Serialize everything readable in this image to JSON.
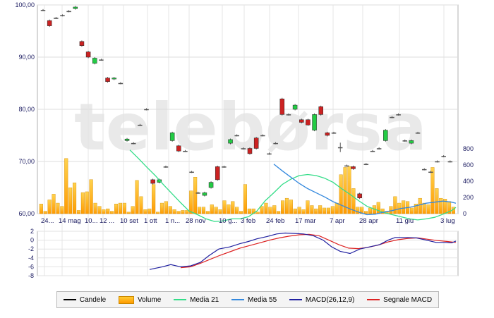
{
  "chart_data": {
    "type": "candlestick",
    "watermark": "telebørsa",
    "price_axis": {
      "range": [
        60,
        100
      ],
      "ticks": [
        "60,00",
        "70,00",
        "80,00",
        "90,00",
        "100,00"
      ]
    },
    "volume_axis": {
      "range": [
        0,
        1000
      ],
      "ticks": [
        "0",
        "200",
        "400",
        "600",
        "800"
      ]
    },
    "macd_axis": {
      "range": [
        -8,
        2
      ],
      "ticks": [
        "2",
        "0",
        "-2",
        "-4",
        "-6",
        "-8"
      ]
    },
    "x_labels": [
      "24...",
      "14 mag",
      "10...",
      "12 ...",
      "10 set",
      "1 ott",
      "1 n...",
      "28 nov",
      "10 g...",
      "3 feb",
      "24 feb",
      "17 mar",
      "7 apr",
      "28 apr",
      "11 giu",
      "3 lug"
    ],
    "legend": [
      {
        "label": "Candele",
        "kind": "line",
        "color": "#000000"
      },
      {
        "label": "Volume",
        "kind": "bar",
        "color": "#ffb000"
      },
      {
        "label": "Media 21",
        "kind": "line",
        "color": "#33dd88"
      },
      {
        "label": "Media 55",
        "kind": "line",
        "color": "#3388dd"
      },
      {
        "label": "MACD(26,12,9)",
        "kind": "line",
        "color": "#2020a0"
      },
      {
        "label": "Segnale MACD",
        "kind": "line",
        "color": "#dd2222"
      }
    ],
    "candles": [
      {
        "o": 99,
        "c": 99,
        "h": 99.2,
        "l": 98.8
      },
      {
        "o": 97,
        "c": 96,
        "h": 97.2,
        "l": 95.8
      },
      {
        "o": 97.5,
        "c": 97.5,
        "h": 97.7,
        "l": 97.3
      },
      {
        "o": 98,
        "c": 98,
        "h": 98.2,
        "l": 97.8
      },
      {
        "o": 98.8,
        "c": 98.8,
        "h": 99,
        "l": 98.6
      },
      {
        "o": 99.3,
        "c": 99.6,
        "h": 99.8,
        "l": 99.1
      },
      {
        "o": 93,
        "c": 92.2,
        "h": 93.2,
        "l": 92
      },
      {
        "o": 91,
        "c": 90,
        "h": 91.2,
        "l": 89.8
      },
      {
        "o": 88.8,
        "c": 89.8,
        "h": 90,
        "l": 88.6
      },
      {
        "o": 89.5,
        "c": 89.5,
        "h": 89.7,
        "l": 89.3
      },
      {
        "o": 86,
        "c": 85.3,
        "h": 86.2,
        "l": 85.1
      },
      {
        "o": 85.8,
        "c": 86,
        "h": 86.2,
        "l": 85.6
      },
      {
        "o": 85,
        "c": 85,
        "h": 85.2,
        "l": 84.8
      },
      {
        "o": 74,
        "c": 74.3,
        "h": 74.5,
        "l": 73.8
      },
      {
        "o": 73.5,
        "c": 73.5,
        "h": 73.7,
        "l": 73.3
      },
      {
        "o": 77,
        "c": 77,
        "h": 77.2,
        "l": 76.8
      },
      {
        "o": 80,
        "c": 80,
        "h": 80.2,
        "l": 79.8
      },
      {
        "o": 66.5,
        "c": 65.8,
        "h": 66.7,
        "l": 65.6
      },
      {
        "o": 66,
        "c": 66.5,
        "h": 66.7,
        "l": 65.8
      },
      {
        "o": 69,
        "c": 69,
        "h": 69.2,
        "l": 68.8
      },
      {
        "o": 74,
        "c": 75.5,
        "h": 75.7,
        "l": 73.8
      },
      {
        "o": 73,
        "c": 72,
        "h": 73.2,
        "l": 71.8
      },
      {
        "o": 72,
        "c": 72,
        "h": 72.2,
        "l": 71.8
      },
      {
        "o": 68,
        "c": 68,
        "h": 68.2,
        "l": 67.8
      },
      {
        "o": 64,
        "c": 64,
        "h": 64.2,
        "l": 63.8
      },
      {
        "o": 63.5,
        "c": 64,
        "h": 64.2,
        "l": 63.3
      },
      {
        "o": 65,
        "c": 66,
        "h": 66.2,
        "l": 64.8
      },
      {
        "o": 69,
        "c": 66.5,
        "h": 69.2,
        "l": 66.3
      },
      {
        "o": 69,
        "c": 69,
        "h": 69.2,
        "l": 68.8
      },
      {
        "o": 73.5,
        "c": 74.2,
        "h": 74.4,
        "l": 73.3
      },
      {
        "o": 75,
        "c": 75,
        "h": 75.2,
        "l": 74.8
      },
      {
        "o": 72.5,
        "c": 72.5,
        "h": 72.7,
        "l": 72.3
      },
      {
        "o": 72.5,
        "c": 71.5,
        "h": 72.7,
        "l": 71.3
      },
      {
        "o": 74.5,
        "c": 72.5,
        "h": 74.7,
        "l": 72.3
      },
      {
        "o": 75,
        "c": 75,
        "h": 75.2,
        "l": 74.8
      },
      {
        "o": 71.5,
        "c": 71.5,
        "h": 71.7,
        "l": 71.3
      },
      {
        "o": 73.5,
        "c": 73.5,
        "h": 73.7,
        "l": 73.3
      },
      {
        "o": 82,
        "c": 79,
        "h": 82.2,
        "l": 78.8
      },
      {
        "o": 79,
        "c": 79,
        "h": 79.2,
        "l": 78.8
      },
      {
        "o": 80,
        "c": 80.8,
        "h": 81,
        "l": 79.8
      },
      {
        "o": 78,
        "c": 77.5,
        "h": 78.2,
        "l": 77.3
      },
      {
        "o": 78,
        "c": 77,
        "h": 78.2,
        "l": 76.8
      },
      {
        "o": 76,
        "c": 79,
        "h": 79.2,
        "l": 75.8
      },
      {
        "o": 80.5,
        "c": 79,
        "h": 80.7,
        "l": 78.8
      },
      {
        "o": 75.5,
        "c": 75,
        "h": 75.7,
        "l": 74.8
      },
      {
        "o": 75.5,
        "c": 75.5,
        "h": 75.7,
        "l": 75.3
      },
      {
        "o": 72.7,
        "c": 72.7,
        "h": 73.6,
        "l": 71.8
      },
      {
        "o": 69.2,
        "c": 69.2,
        "h": 69.4,
        "l": 69
      },
      {
        "o": 69,
        "c": 68.6,
        "h": 69.2,
        "l": 68.4
      },
      {
        "o": 63.8,
        "c": 63,
        "h": 64,
        "l": 62.8
      },
      {
        "o": 69.5,
        "c": 69.5,
        "h": 69.7,
        "l": 69.3
      },
      {
        "o": 72,
        "c": 72,
        "h": 72.2,
        "l": 71.8
      },
      {
        "o": 72.5,
        "c": 72.5,
        "h": 72.7,
        "l": 72.3
      },
      {
        "o": 74,
        "c": 76,
        "h": 76.2,
        "l": 73.8
      },
      {
        "o": 78.5,
        "c": 78.5,
        "h": 78.7,
        "l": 78.3
      },
      {
        "o": 79,
        "c": 79,
        "h": 79.2,
        "l": 78.8
      },
      {
        "o": 74,
        "c": 74,
        "h": 74.2,
        "l": 73.8
      },
      {
        "o": 73.5,
        "c": 74,
        "h": 74.2,
        "l": 73.3
      },
      {
        "o": 75.5,
        "c": 75.5,
        "h": 75.7,
        "l": 75.3
      },
      {
        "o": 68.5,
        "c": 68.5,
        "h": 68.7,
        "l": 68.3
      },
      {
        "o": 68,
        "c": 68,
        "h": 68.2,
        "l": 67.8
      },
      {
        "o": 70,
        "c": 70,
        "h": 70.2,
        "l": 69.8
      },
      {
        "o": 71,
        "c": 71,
        "h": 71.2,
        "l": 70.8
      },
      {
        "o": 70,
        "c": 70,
        "h": 70.2,
        "l": 69.8
      }
    ],
    "volume": [
      120,
      30,
      170,
      240,
      130,
      90,
      680,
      320,
      380,
      40,
      260,
      270,
      420,
      130,
      90,
      50,
      60,
      30,
      120,
      130,
      130,
      20,
      90,
      410,
      210,
      50,
      60,
      360,
      20,
      130,
      150,
      90,
      50,
      30,
      40,
      40,
      280,
      450,
      80,
      80,
      30,
      110,
      80,
      50,
      160,
      110,
      150,
      80,
      30,
      360,
      60,
      60,
      20,
      90,
      130,
      80,
      100,
      30,
      160,
      190,
      170,
      60,
      80,
      50,
      160,
      100,
      60,
      100,
      70,
      70,
      90,
      130,
      480,
      570,
      580,
      310,
      80,
      80,
      30,
      70,
      100,
      140,
      60,
      30,
      90,
      210,
      130,
      160,
      150,
      70,
      120,
      190,
      130,
      110,
      570,
      310,
      190,
      180,
      150,
      80
    ],
    "media21": [
      [
        184,
        72.2
      ],
      [
        196,
        70.6
      ],
      [
        208,
        68.9
      ],
      [
        220,
        67.3
      ],
      [
        232,
        65.5
      ],
      [
        244,
        63.8
      ],
      [
        256,
        62.1
      ],
      [
        268,
        60.5
      ],
      [
        280,
        59.8
      ],
      [
        292,
        59
      ],
      [
        304,
        58.5
      ],
      [
        316,
        58.6
      ],
      [
        328,
        59
      ],
      [
        340,
        59
      ],
      [
        352,
        59.4
      ],
      [
        364,
        60.5
      ],
      [
        376,
        62.5
      ],
      [
        388,
        64
      ],
      [
        400,
        65.6
      ],
      [
        412,
        66.6
      ],
      [
        424,
        67.3
      ],
      [
        436,
        67.5
      ],
      [
        448,
        67.3
      ],
      [
        460,
        66.8
      ],
      [
        472,
        66
      ],
      [
        484,
        64.8
      ],
      [
        496,
        63.7
      ],
      [
        508,
        62.5
      ],
      [
        520,
        61.4
      ],
      [
        532,
        60.8
      ],
      [
        544,
        60.2
      ],
      [
        556,
        59.8
      ],
      [
        568,
        59.4
      ],
      [
        580,
        59
      ],
      [
        592,
        58.8
      ],
      [
        604,
        59
      ],
      [
        616,
        59.3
      ],
      [
        628,
        59.9
      ],
      [
        640,
        60.6
      ],
      [
        646,
        61.2
      ]
    ],
    "media55": [
      [
        388,
        69.5
      ],
      [
        400,
        68.2
      ],
      [
        412,
        67
      ],
      [
        424,
        65.8
      ],
      [
        436,
        64.8
      ],
      [
        448,
        64
      ],
      [
        460,
        63.2
      ],
      [
        472,
        62.3
      ],
      [
        484,
        61.6
      ],
      [
        496,
        60.9
      ],
      [
        508,
        60.3
      ],
      [
        520,
        59.8
      ],
      [
        532,
        59.9
      ],
      [
        544,
        60.3
      ],
      [
        556,
        60.6
      ],
      [
        568,
        61
      ],
      [
        580,
        61.2
      ],
      [
        592,
        61.6
      ],
      [
        604,
        62
      ],
      [
        616,
        62.2
      ],
      [
        628,
        62.4
      ],
      [
        640,
        62.2
      ],
      [
        646,
        62
      ]
    ],
    "macd": [
      [
        212,
        -6.6
      ],
      [
        230,
        -6
      ],
      [
        242,
        -5.5
      ],
      [
        256,
        -6
      ],
      [
        270,
        -5.8
      ],
      [
        284,
        -5
      ],
      [
        296,
        -3.5
      ],
      [
        310,
        -2
      ],
      [
        326,
        -1.5
      ],
      [
        340,
        -0.8
      ],
      [
        352,
        -0.3
      ],
      [
        364,
        0.3
      ],
      [
        378,
        0.8
      ],
      [
        392,
        1.4
      ],
      [
        404,
        1.6
      ],
      [
        418,
        1.5
      ],
      [
        430,
        1.4
      ],
      [
        444,
        1
      ],
      [
        458,
        0
      ],
      [
        470,
        -1.5
      ],
      [
        482,
        -2.5
      ],
      [
        496,
        -3
      ],
      [
        510,
        -2
      ],
      [
        524,
        -1.5
      ],
      [
        538,
        -1
      ],
      [
        550,
        0
      ],
      [
        560,
        0.6
      ],
      [
        574,
        0.6
      ],
      [
        590,
        0.5
      ],
      [
        604,
        0
      ],
      [
        618,
        -0.5
      ],
      [
        630,
        -0.5
      ],
      [
        640,
        -0.6
      ],
      [
        646,
        -0.2
      ]
    ],
    "macd_signal": [
      [
        256,
        -6.2
      ],
      [
        270,
        -6
      ],
      [
        284,
        -5.2
      ],
      [
        298,
        -4.3
      ],
      [
        312,
        -3.4
      ],
      [
        326,
        -2.6
      ],
      [
        340,
        -1.8
      ],
      [
        354,
        -1.2
      ],
      [
        368,
        -0.6
      ],
      [
        382,
        0
      ],
      [
        396,
        0.5
      ],
      [
        410,
        0.9
      ],
      [
        424,
        1.2
      ],
      [
        438,
        1.3
      ],
      [
        452,
        1
      ],
      [
        466,
        0
      ],
      [
        480,
        -1
      ],
      [
        494,
        -1.8
      ],
      [
        508,
        -1.9
      ],
      [
        522,
        -1.6
      ],
      [
        536,
        -1.1
      ],
      [
        550,
        -0.4
      ],
      [
        564,
        0.1
      ],
      [
        578,
        0.4
      ],
      [
        592,
        0.5
      ],
      [
        606,
        0.2
      ],
      [
        620,
        -0.1
      ],
      [
        634,
        -0.3
      ],
      [
        646,
        -0.5
      ]
    ]
  }
}
